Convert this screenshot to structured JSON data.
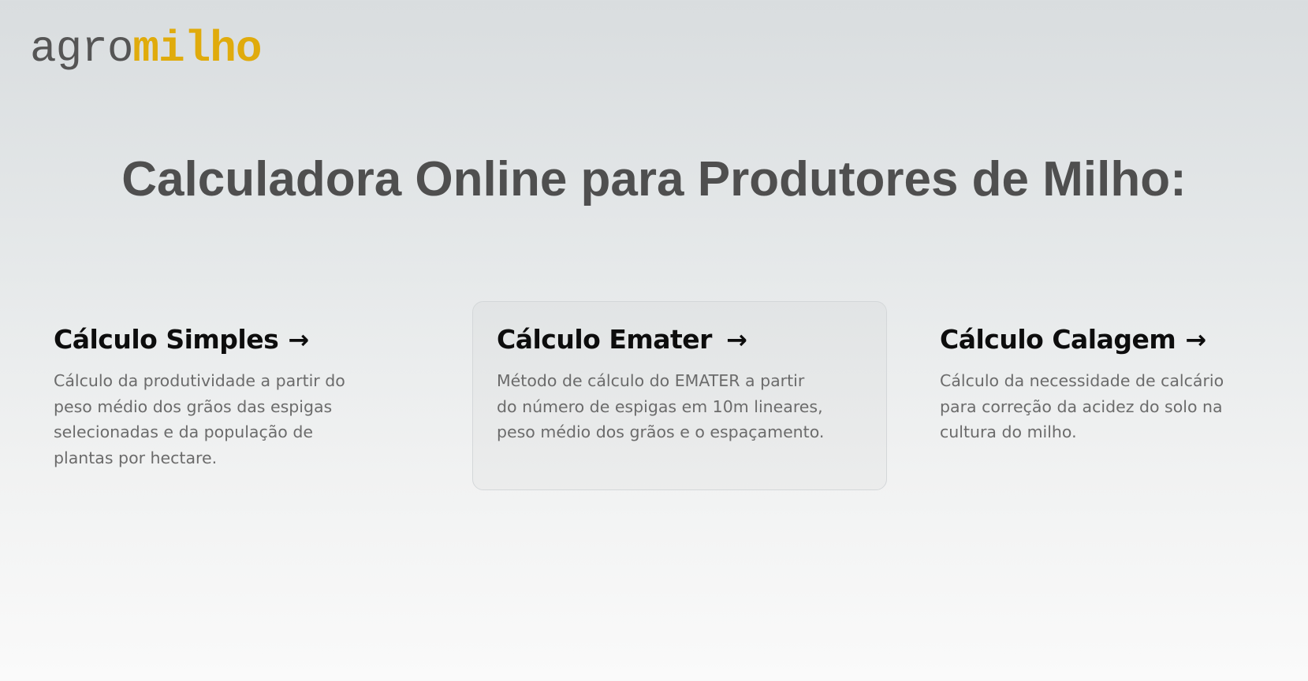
{
  "logo": {
    "part1": "agro",
    "part2": "milho"
  },
  "headline": "Calculadora Online para Produtores de Milho:",
  "cards": [
    {
      "title": "Cálculo Simples",
      "arrow": "→",
      "description": "Cálculo da produtividade a partir do peso médio dos grãos das espigas selecionadas e da população de plantas por hectare."
    },
    {
      "title": "Cálculo Emater",
      "arrow": "→",
      "description": "Método de cálculo do EMATER a partir do número de espigas em 10m lineares, peso médio dos grãos e o espaçamento."
    },
    {
      "title": "Cálculo Calagem",
      "arrow": "→",
      "description": "Cálculo da necessidade de calcário para correção da acidez do solo na cultura do milho."
    }
  ],
  "colors": {
    "logo_accent": "#e0ab0c",
    "logo_gray": "#555555",
    "headline": "#4f4f4f",
    "card_title": "#0d0d0d",
    "card_desc": "#6b6b6b"
  }
}
